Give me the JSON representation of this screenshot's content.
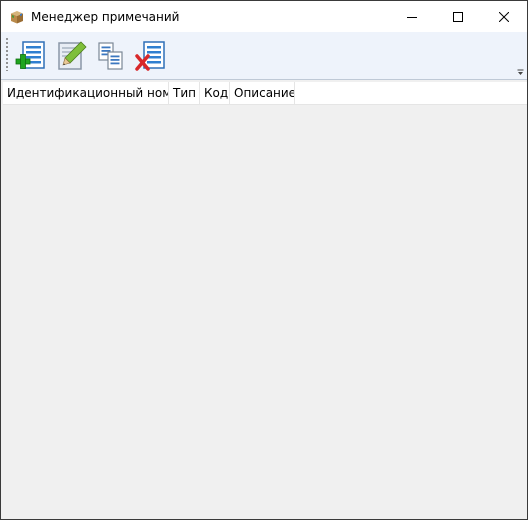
{
  "window": {
    "title": "Менеджер примечаний",
    "app_icon": "package-box-icon",
    "controls": [
      "minimize-icon",
      "maximize-icon",
      "close-icon"
    ]
  },
  "toolbar": {
    "buttons": [
      {
        "name": "add-note-button",
        "icon": "document-list-plus-icon"
      },
      {
        "name": "edit-note-button",
        "icon": "pencil-edit-icon"
      },
      {
        "name": "copy-note-button",
        "icon": "copy-documents-icon"
      },
      {
        "name": "delete-note-button",
        "icon": "document-delete-x-icon"
      }
    ]
  },
  "grid": {
    "columns": [
      "Идентификационный номер",
      "Тип",
      "Код",
      "Описание"
    ],
    "rows": []
  },
  "colors": {
    "toolbar_bg": "#eef3fb",
    "grid_bg": "#f0f0f0",
    "add_green": "#1fa51f",
    "delete_red": "#d8282b",
    "doc_blue": "#2f7fd0"
  }
}
